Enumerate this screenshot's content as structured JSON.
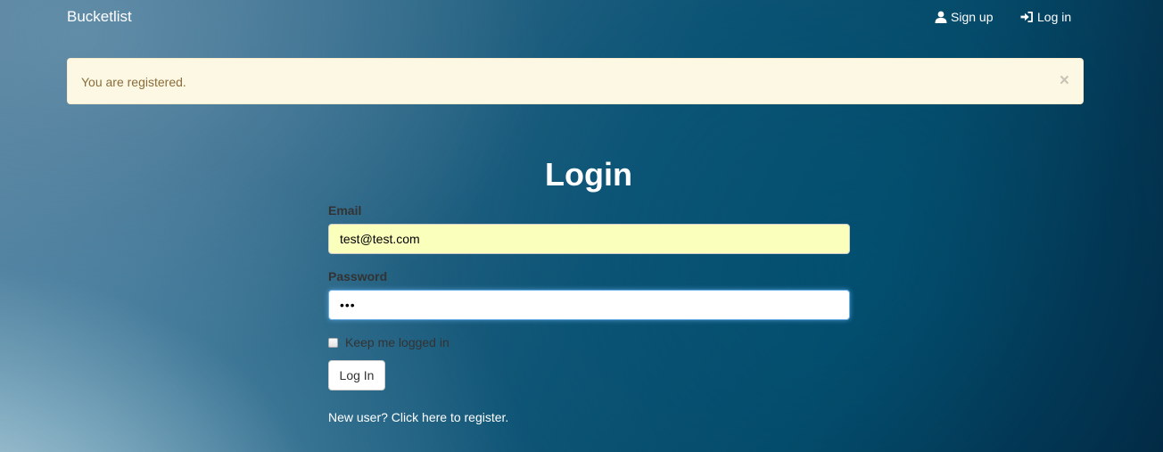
{
  "navbar": {
    "brand": "Bucketlist",
    "signup_label": "Sign up",
    "login_label": "Log in",
    "signup_icon": "user-icon",
    "login_icon": "log-in-icon"
  },
  "alert": {
    "message": "You are registered.",
    "close_symbol": "×"
  },
  "login_form": {
    "title": "Login",
    "email_label": "Email",
    "email_value": "test@test.com",
    "password_label": "Password",
    "password_value": "•••",
    "remember_label": "Keep me logged in",
    "remember_checked": false,
    "submit_label": "Log In",
    "register_link": "New user? Click here to register."
  },
  "colors": {
    "alert_background": "#fcf8e3",
    "alert_text": "#8a6d3b",
    "email_autofill": "#fbffbc",
    "focus_border": "#66afe9"
  }
}
